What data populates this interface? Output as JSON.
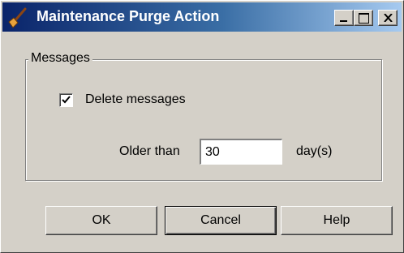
{
  "window": {
    "title": "Maintenance Purge Action",
    "icon": "broom-icon",
    "controls": {
      "minimize": "minimize-icon",
      "maximize": "maximize-icon",
      "close": "close-icon"
    }
  },
  "group": {
    "label": "Messages",
    "delete_checkbox": {
      "label": "Delete messages",
      "checked": true
    },
    "older_than": {
      "label": "Older than",
      "value": "30",
      "unit": "day(s)"
    }
  },
  "buttons": {
    "ok": "OK",
    "cancel": "Cancel",
    "help": "Help"
  },
  "colors": {
    "face": "#d4d0c8",
    "title_start": "#0a246a",
    "title_end": "#a6caf0"
  }
}
